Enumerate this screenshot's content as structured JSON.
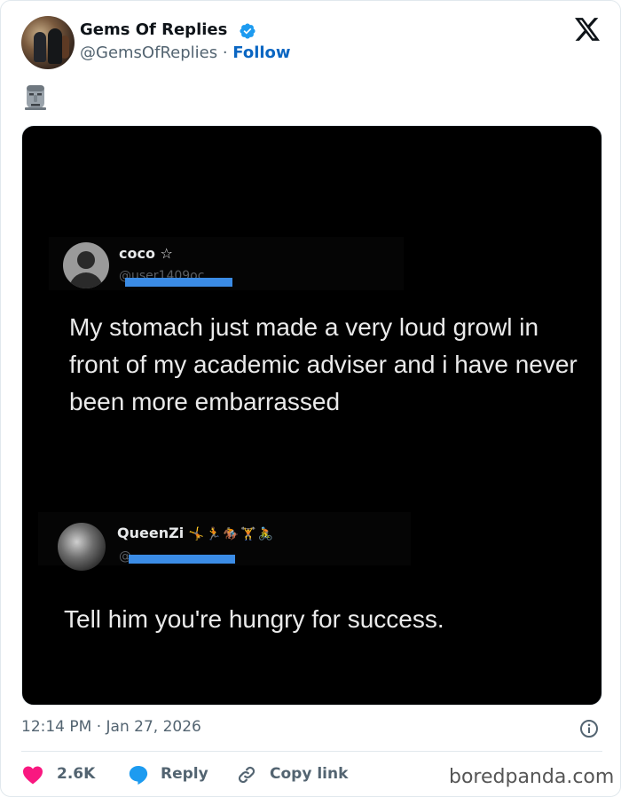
{
  "author": {
    "name": "Gems Of Replies",
    "handle": "@GemsOfReplies",
    "separator": " · ",
    "follow_label": "Follow"
  },
  "post": {
    "text_emoji": "moai-emoji",
    "embedded_image": {
      "tweet1": {
        "username": "coco ☆",
        "handle_fragment": "@user1409oc",
        "text": "My stomach just made a very loud growl in front of my academic adviser and i have never been more embarrassed"
      },
      "tweet2": {
        "username": "QueenZi",
        "username_emojis": "🤸🏃🏇🏋🚴",
        "handle_fragment": "@",
        "text": "Tell him you're hungry for success."
      }
    },
    "timestamp": "12:14 PM · Jan 27, 2026"
  },
  "actions": {
    "likes": "2.6K",
    "reply_label": "Reply",
    "copy_link_label": "Copy link"
  },
  "watermark": "boredpanda.com",
  "colors": {
    "follow_blue": "#0a66c2",
    "verified_blue": "#1d9bf0",
    "heart_red": "#f91880",
    "redaction_blue": "#3b8ce6"
  }
}
